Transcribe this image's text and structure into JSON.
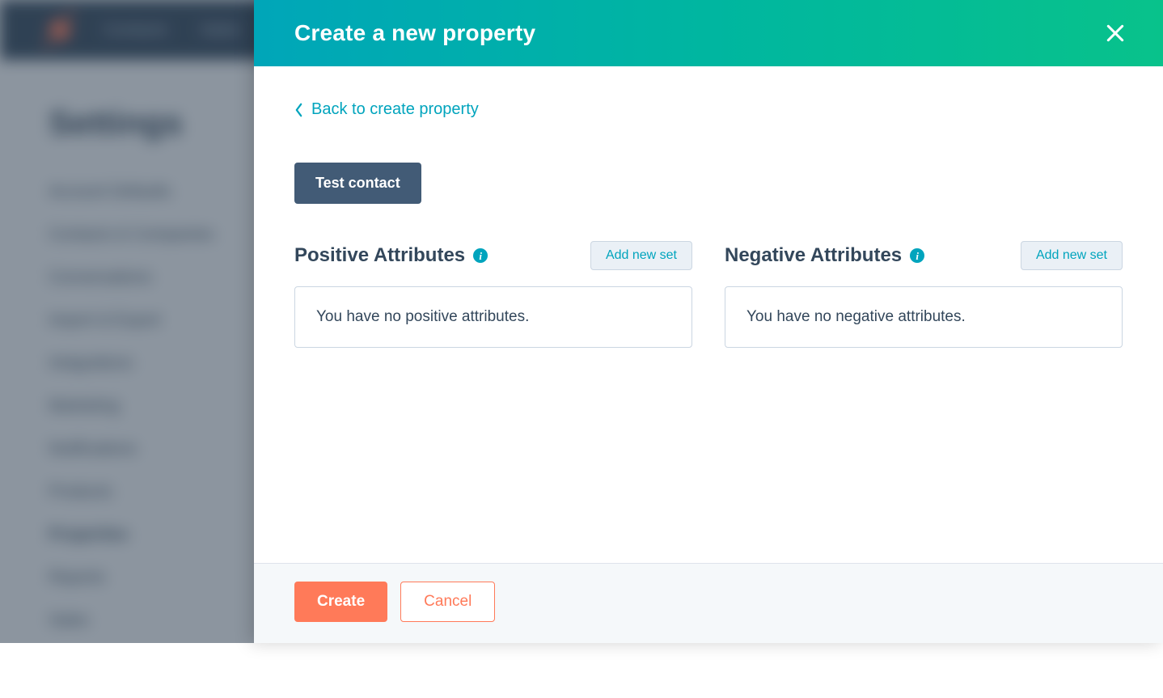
{
  "background": {
    "nav_items": [
      "Contacts",
      "Sales"
    ],
    "page_title": "Settings",
    "sidebar": [
      "Account Defaults",
      "Contacts & Companies",
      "Conversations",
      "Import & Export",
      "Integrations",
      "Marketing",
      "Notifications",
      "Products",
      "Properties",
      "Reports",
      "Sales"
    ]
  },
  "modal": {
    "title": "Create a new property",
    "back_label": "Back to create property",
    "test_button_label": "Test contact",
    "positive": {
      "title": "Positive Attributes",
      "add_button": "Add new set",
      "empty_message": "You have no positive attributes."
    },
    "negative": {
      "title": "Negative Attributes",
      "add_button": "Add new set",
      "empty_message": "You have no negative attributes."
    },
    "footer": {
      "create": "Create",
      "cancel": "Cancel"
    }
  }
}
